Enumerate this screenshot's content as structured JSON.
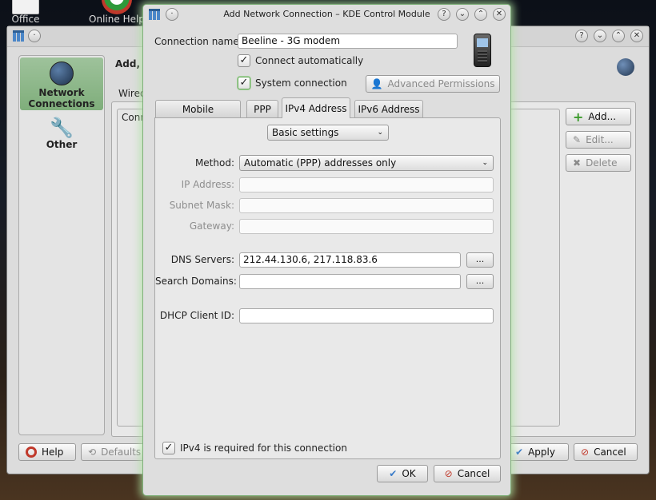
{
  "desktop": {
    "icons": [
      {
        "label": "Office"
      },
      {
        "label": "Online Help"
      }
    ]
  },
  "background_window": {
    "header_text": "Add, E",
    "sidebar": [
      {
        "label": "Network Connections",
        "icon": "network-globe-icon"
      },
      {
        "label": "Other",
        "icon": "wrench-tools-icon"
      }
    ],
    "tab_partial": "Wired",
    "column_partial": "Conn",
    "buttons": {
      "add": "Add...",
      "edit": "Edit...",
      "delete": "Delete",
      "help": "Help",
      "defaults": "Defaults",
      "apply": "Apply",
      "cancel": "Cancel"
    }
  },
  "dialog": {
    "title": "Add Network Connection – KDE Control Module",
    "connection_name_label": "Connection name:",
    "connection_name_value": "Beeline - 3G modem",
    "connect_automatically": {
      "label": "Connect automatically",
      "checked": true
    },
    "system_connection": {
      "label": "System connection",
      "checked": true
    },
    "advanced_permissions": "Advanced Permissions",
    "tabs": [
      {
        "label": "Mobile Broadband",
        "active": false
      },
      {
        "label": "PPP",
        "active": false
      },
      {
        "label": "IPv4 Address",
        "active": true
      },
      {
        "label": "IPv6 Address",
        "active": false
      }
    ],
    "settings_mode": "Basic settings",
    "method": {
      "label": "Method:",
      "value": "Automatic (PPP) addresses only"
    },
    "ip_address": {
      "label": "IP Address:",
      "value": ""
    },
    "subnet_mask": {
      "label": "Subnet Mask:",
      "value": ""
    },
    "gateway": {
      "label": "Gateway:",
      "value": ""
    },
    "dns_servers": {
      "label": "DNS Servers:",
      "value": "212.44.130.6, 217.118.83.6"
    },
    "search_domains": {
      "label": "Search Domains:",
      "value": ""
    },
    "dhcp_client_id": {
      "label": "DHCP Client ID:",
      "value": ""
    },
    "ellipsis": "...",
    "ipv4_required": {
      "label": "IPv4 is required for this connection",
      "checked": true
    },
    "ok": "OK",
    "cancel": "Cancel"
  }
}
